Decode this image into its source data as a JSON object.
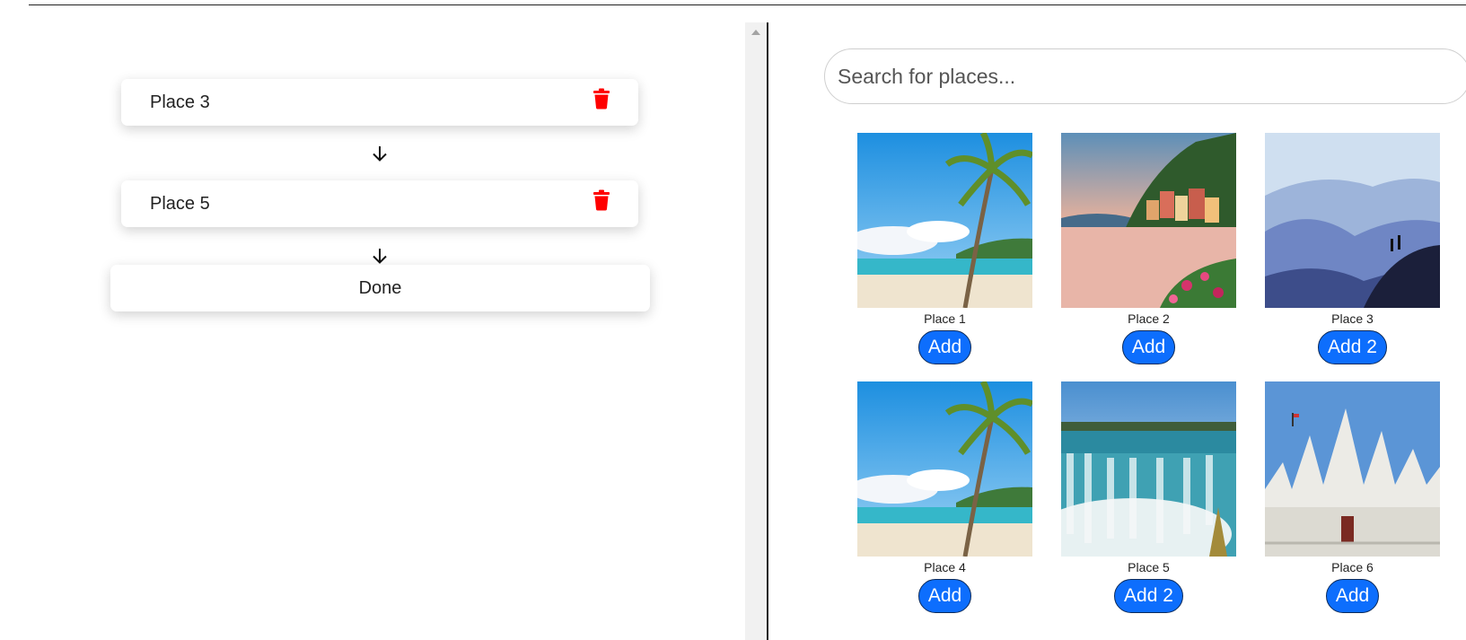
{
  "itinerary": {
    "items": [
      {
        "label": "Place 3",
        "icon": "trash-icon"
      },
      {
        "label": "Place 5",
        "icon": "trash-icon"
      }
    ],
    "arrow_icon": "arrow-down-icon",
    "done_label": "Done"
  },
  "search": {
    "placeholder": "Search for places..."
  },
  "places": [
    {
      "name": "Place 1",
      "button": "Add",
      "scene": "tropical beach with palm trees"
    },
    {
      "name": "Place 2",
      "button": "Add",
      "scene": "lakeside village at sunset"
    },
    {
      "name": "Place 3",
      "button": "Add 2",
      "scene": "misty blue mountains with hikers"
    },
    {
      "name": "Place 4",
      "button": "Add",
      "scene": "tropical beach with palm trees"
    },
    {
      "name": "Place 5",
      "button": "Add 2",
      "scene": "waterfall"
    },
    {
      "name": "Place 6",
      "button": "Add",
      "scene": "white marble temple"
    }
  ],
  "colors": {
    "accent": "#0d6efd",
    "trash": "#ff0000"
  }
}
